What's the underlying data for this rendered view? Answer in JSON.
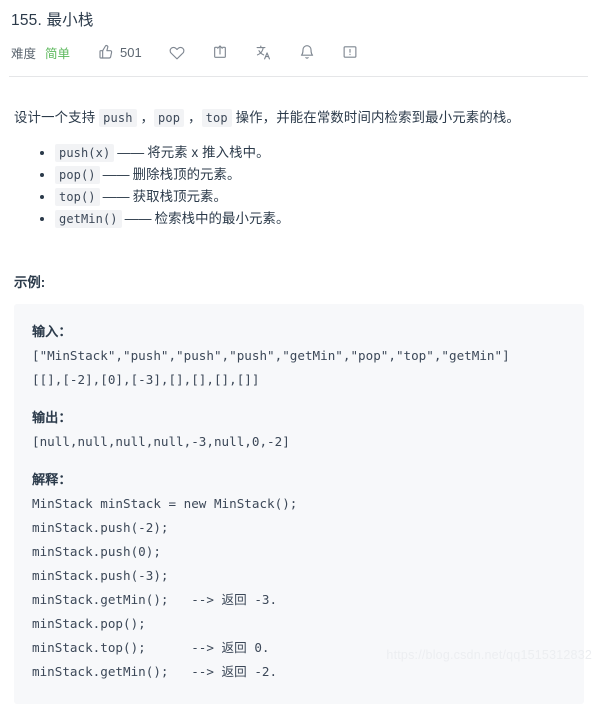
{
  "header": {
    "title": "155. 最小栈",
    "difficulty_label": "难度",
    "difficulty_value": "简单",
    "vote_count": "501",
    "icons": {
      "like": "thumbs-up-icon",
      "favorite": "heart-icon",
      "share": "share-icon",
      "translate": "translate-icon",
      "notify": "bell-icon",
      "report": "report-icon"
    }
  },
  "description": {
    "part1": "设计一个支持 ",
    "code_push": "push",
    "sep1": " ，",
    "code_pop": "pop",
    "sep2": " ，",
    "code_top": "top",
    "part2": " 操作，并能在常数时间内检索到最小元素的栈。"
  },
  "operations": [
    {
      "code": "push(x)",
      "dash": "——",
      "text": "将元素 x 推入栈中。"
    },
    {
      "code": "pop()",
      "dash": "——",
      "text": "删除栈顶的元素。"
    },
    {
      "code": "top()",
      "dash": "——",
      "text": "获取栈顶元素。"
    },
    {
      "code": "getMin()",
      "dash": "——",
      "text": "检索栈中的最小元素。"
    }
  ],
  "example": {
    "heading": "示例:",
    "input_label": "输入：",
    "input_lines": "[\"MinStack\",\"push\",\"push\",\"push\",\"getMin\",\"pop\",\"top\",\"getMin\"]\n[[],[-2],[0],[-3],[],[],[],[]]",
    "output_label": "输出：",
    "output_lines": "[null,null,null,null,-3,null,0,-2]",
    "explain_label": "解释：",
    "explain_lines": "MinStack minStack = new MinStack();\nminStack.push(-2);\nminStack.push(0);\nminStack.push(-3);\nminStack.getMin();   --> 返回 -3.\nminStack.pop();\nminStack.top();      --> 返回 0.\nminStack.getMin();   --> 返回 -2."
  },
  "watermark": "https://blog.csdn.net/qq1515312832",
  "colors": {
    "difficulty_green": "#5cb85c",
    "text": "#2b3a4a",
    "code_bg": "#f2f3f5",
    "example_bg": "#f7f8fa",
    "divider": "#e5e6e8"
  }
}
